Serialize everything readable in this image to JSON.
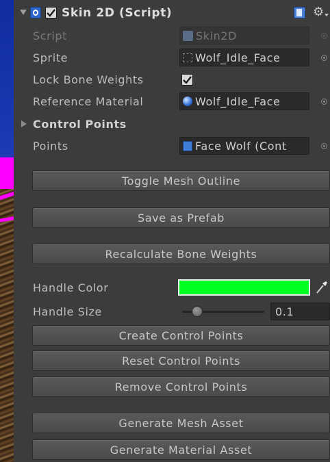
{
  "component": {
    "title": "Skin 2D (Script)",
    "enabled": true
  },
  "fields": {
    "script_label": "Script",
    "script_value": "Skin2D",
    "sprite_label": "Sprite",
    "sprite_value": "Wolf_Idle_Face",
    "lock_label": "Lock Bone Weights",
    "lock_checked": true,
    "material_label": "Reference Material",
    "material_value": "Wolf_Idle_Face",
    "control_points_label": "Control Points",
    "points_label": "Points",
    "points_value": "Face Wolf (Cont"
  },
  "buttons": {
    "toggle_mesh_outline": "Toggle Mesh Outline",
    "save_as_prefab": "Save as Prefab",
    "recalculate_bone_weights": "Recalculate Bone Weights",
    "create_control_points": "Create Control Points",
    "reset_control_points": "Reset Control Points",
    "remove_control_points": "Remove Control Points",
    "generate_mesh_asset": "Generate Mesh Asset",
    "generate_material_asset": "Generate Material Asset"
  },
  "handle": {
    "color_label": "Handle Color",
    "color_value": "#00ff22",
    "size_label": "Handle Size",
    "size_value": "0.1",
    "size_fraction": 0.1
  },
  "colors": {
    "panel_bg": "#3c3c3c",
    "accent_blue": "#3b6fd4"
  }
}
